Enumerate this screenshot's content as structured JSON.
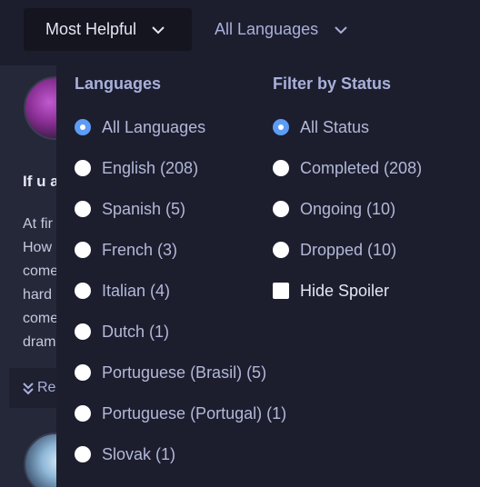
{
  "toolbar": {
    "sort_label": "Most Helpful",
    "language_label": "All Languages"
  },
  "review": {
    "title": "If u a",
    "lines": [
      "At fir",
      "How",
      "come",
      "hard",
      "come",
      "dram"
    ],
    "read_more": "Re"
  },
  "filters": {
    "languages_heading": "Languages",
    "status_heading": "Filter by Status",
    "languages": [
      {
        "label": "All Languages",
        "checked": true
      },
      {
        "label": "English (208)",
        "checked": false
      },
      {
        "label": "Spanish (5)",
        "checked": false
      },
      {
        "label": "French (3)",
        "checked": false
      },
      {
        "label": "Italian (4)",
        "checked": false
      },
      {
        "label": "Dutch (1)",
        "checked": false
      },
      {
        "label": "Portuguese (Brasil) (5)",
        "checked": false
      },
      {
        "label": "Portuguese (Portugal) (1)",
        "checked": false
      },
      {
        "label": "Slovak (1)",
        "checked": false
      }
    ],
    "status": [
      {
        "label": "All Status",
        "checked": true
      },
      {
        "label": "Completed (208)",
        "checked": false
      },
      {
        "label": "Ongoing (10)",
        "checked": false
      },
      {
        "label": "Dropped (10)",
        "checked": false
      }
    ],
    "hide_spoiler": "Hide Spoiler"
  },
  "colors": {
    "accent": "#5d9cf5",
    "panel_bg": "#1c1e2e",
    "content_bg": "#252838"
  }
}
